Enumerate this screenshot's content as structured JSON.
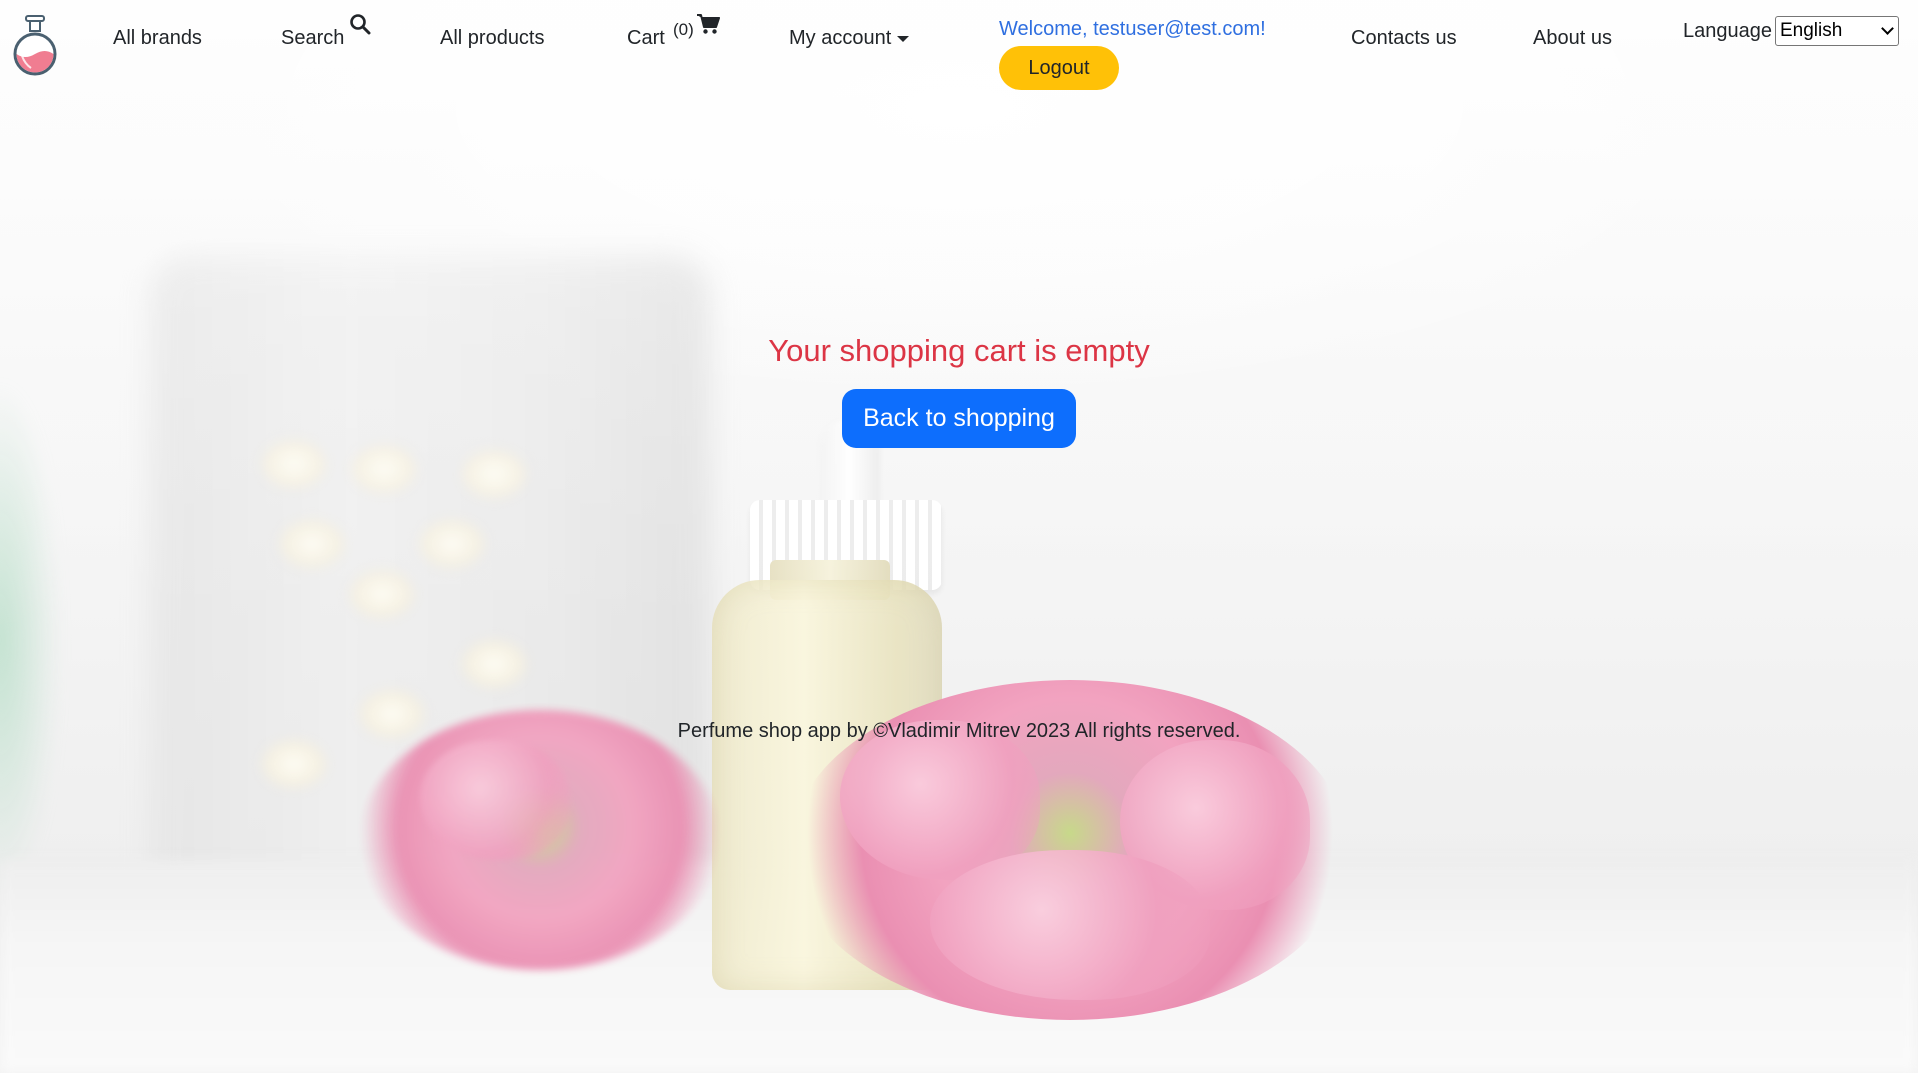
{
  "navbar": {
    "logo_icon": "perfume-bottle-icon",
    "items": [
      {
        "label": "All brands"
      },
      {
        "label": "Search",
        "icon": "search-icon"
      },
      {
        "label": "All products"
      },
      {
        "label": "Cart",
        "count": "(0)",
        "icon": "cart-icon"
      },
      {
        "label": "My account",
        "icon": "caret-down-icon"
      },
      {
        "label": "Contacts us"
      },
      {
        "label": "About us"
      }
    ],
    "welcome": "Welcome, testuser@test.com!",
    "logout_label": "Logout",
    "language_label": "Language",
    "language_selected": "English"
  },
  "main": {
    "empty_message": "Your shopping cart is empty",
    "back_button_label": "Back to shopping"
  },
  "footer": {
    "text": "Perfume shop app by ©Vladimir Mitrev 2023 All rights reserved."
  },
  "colors": {
    "welcome_text": "#2f6fe0",
    "logout_button": "#ffc107",
    "empty_message": "#dc3545",
    "primary_button": "#0d6efd"
  }
}
